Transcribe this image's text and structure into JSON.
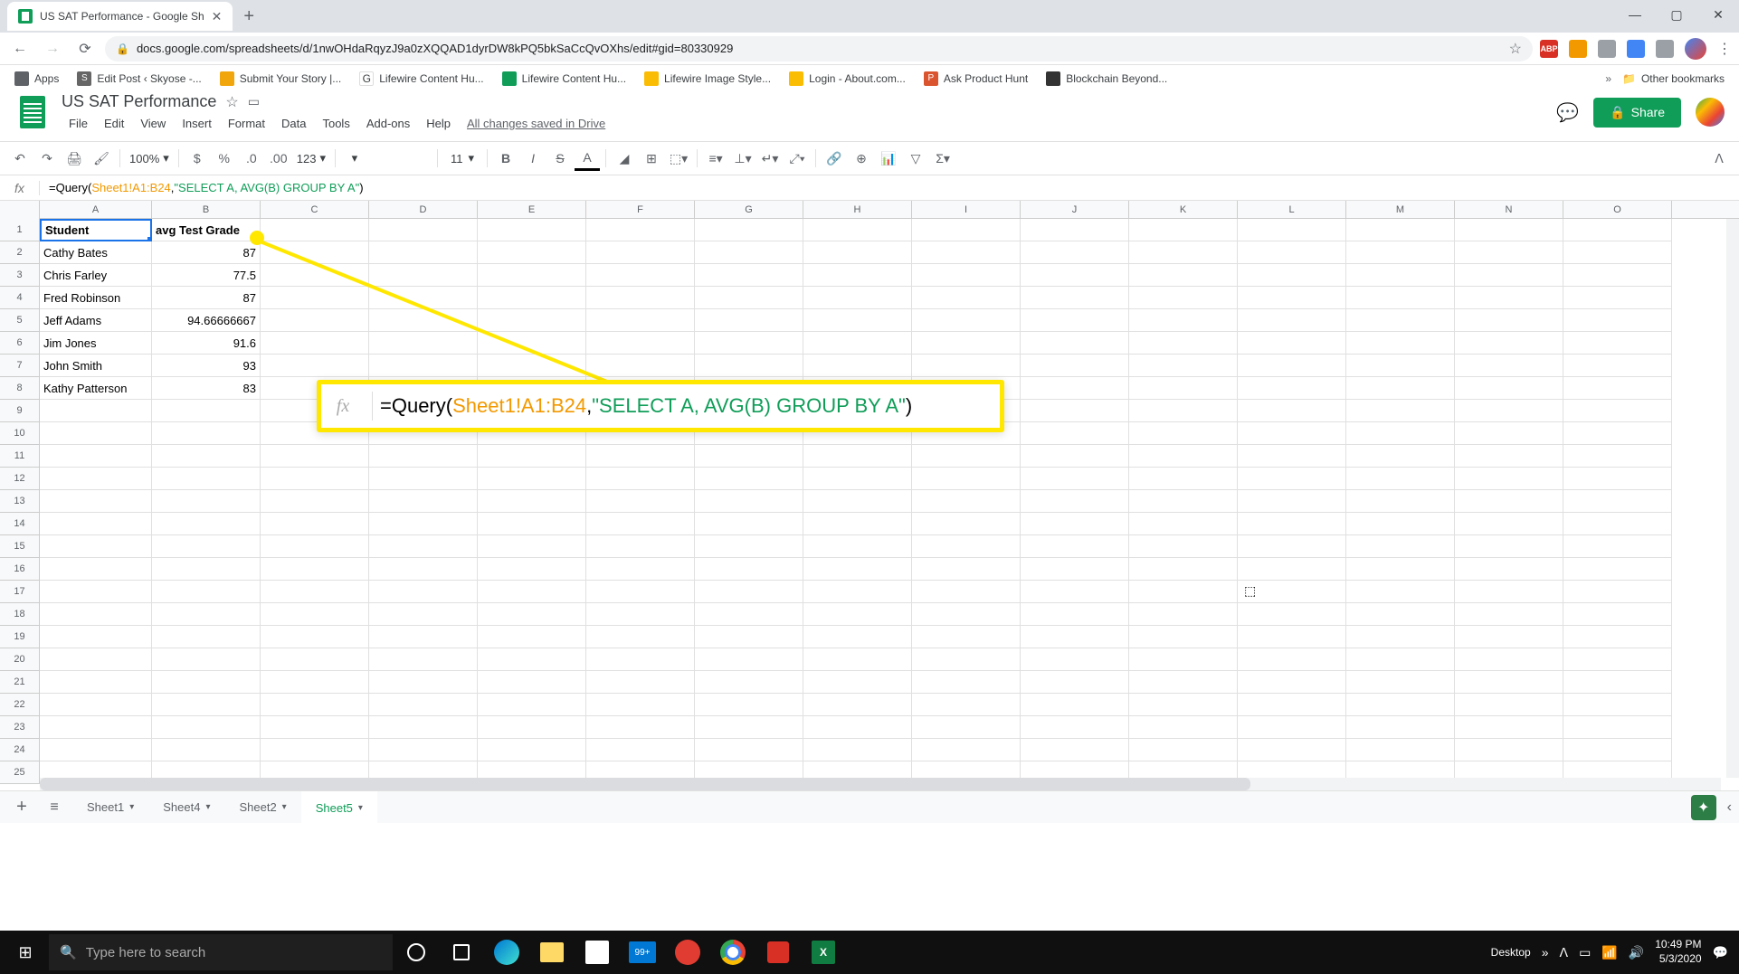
{
  "browser": {
    "tab_title": "US SAT Performance - Google Sh",
    "url": "docs.google.com/spreadsheets/d/1nwOHdaRqyzJ9a0zXQQAD1dyrDW8kPQ5bkSaCcQvOXhs/edit#gid=80330929",
    "bookmarks": [
      "Apps",
      "Edit Post ‹ Skyose -...",
      "Submit Your Story |...",
      "Lifewire Content Hu...",
      "Lifewire Content Hu...",
      "Lifewire Image Style...",
      "Login - About.com...",
      "Ask Product Hunt",
      "Blockchain Beyond..."
    ],
    "other_bookmarks": "Other bookmarks"
  },
  "sheets": {
    "doc_title": "US SAT Performance",
    "menus": [
      "File",
      "Edit",
      "View",
      "Insert",
      "Format",
      "Data",
      "Tools",
      "Add-ons",
      "Help"
    ],
    "saved": "All changes saved in Drive",
    "share": "Share",
    "zoom": "100%",
    "font_size": "11",
    "num_format": "123"
  },
  "formula": {
    "prefix": "=Query(",
    "ref": "Sheet1!A1:B24",
    "mid": ",",
    "str": "\"SELECT A, AVG(B) GROUP BY A\"",
    "suffix": ")"
  },
  "callout": {
    "prefix": "=Query(",
    "ref": "Sheet1!A1:B24",
    "mid": ",",
    "str": "\"SELECT A, AVG(B) GROUP BY A\"",
    "suffix": ")"
  },
  "columns": [
    "A",
    "B",
    "C",
    "D",
    "E",
    "F",
    "G",
    "H",
    "I",
    "J",
    "K",
    "L",
    "M",
    "N",
    "O"
  ],
  "data_rows": [
    {
      "r": "1",
      "a": "Student",
      "b": "avg Test Grade",
      "bold": true
    },
    {
      "r": "2",
      "a": "Cathy Bates",
      "b": "87"
    },
    {
      "r": "3",
      "a": "Chris Farley",
      "b": "77.5"
    },
    {
      "r": "4",
      "a": "Fred Robinson",
      "b": "87"
    },
    {
      "r": "5",
      "a": "Jeff Adams",
      "b": "94.66666667"
    },
    {
      "r": "6",
      "a": "Jim Jones",
      "b": "91.6"
    },
    {
      "r": "7",
      "a": "John Smith",
      "b": "93"
    },
    {
      "r": "8",
      "a": "Kathy Patterson",
      "b": "83"
    }
  ],
  "empty_rows": [
    "9",
    "10",
    "11",
    "12",
    "13",
    "14",
    "15",
    "16",
    "17",
    "18",
    "19",
    "20",
    "21",
    "22",
    "23",
    "24",
    "25"
  ],
  "sheet_tabs": [
    {
      "name": "Sheet1",
      "active": false
    },
    {
      "name": "Sheet4",
      "active": false
    },
    {
      "name": "Sheet2",
      "active": false
    },
    {
      "name": "Sheet5",
      "active": true
    }
  ],
  "taskbar": {
    "search_placeholder": "Type here to search",
    "badge": "99+",
    "desktop": "Desktop",
    "time": "10:49 PM",
    "date": "5/3/2020"
  }
}
